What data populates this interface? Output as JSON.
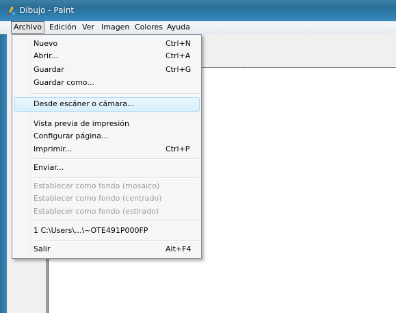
{
  "window": {
    "title": "Dibujo - Paint"
  },
  "menubar": {
    "items": [
      {
        "label": "Archivo"
      },
      {
        "label": "Edición"
      },
      {
        "label": "Ver"
      },
      {
        "label": "Imagen"
      },
      {
        "label": "Colores"
      },
      {
        "label": "Ayuda"
      }
    ]
  },
  "file_menu": {
    "items": [
      {
        "label": "Nuevo",
        "shortcut": "Ctrl+N"
      },
      {
        "label": "Abrir...",
        "shortcut": "Ctrl+A"
      },
      {
        "label": "Guardar",
        "shortcut": "Ctrl+G"
      },
      {
        "label": "Guardar como...",
        "shortcut": ""
      },
      {
        "label": "Desde escáner o cámara...",
        "shortcut": ""
      },
      {
        "label": "Vista previa de impresión",
        "shortcut": ""
      },
      {
        "label": "Configurar página...",
        "shortcut": ""
      },
      {
        "label": "Imprimir...",
        "shortcut": "Ctrl+P"
      },
      {
        "label": "Enviar...",
        "shortcut": ""
      },
      {
        "label": "Establecer como fondo (mosaico)",
        "shortcut": ""
      },
      {
        "label": "Establecer como fondo (centrado)",
        "shortcut": ""
      },
      {
        "label": "Establecer como fondo (estirado)",
        "shortcut": ""
      },
      {
        "label": "1 C:\\Users\\...\\~OTE491P000FP",
        "shortcut": ""
      },
      {
        "label": "Salir",
        "shortcut": "Alt+F4"
      }
    ]
  },
  "colors": {
    "titlebar": "#2a6f98",
    "menu_highlight": "#d9effc",
    "disabled_text": "#9c9c9c"
  }
}
